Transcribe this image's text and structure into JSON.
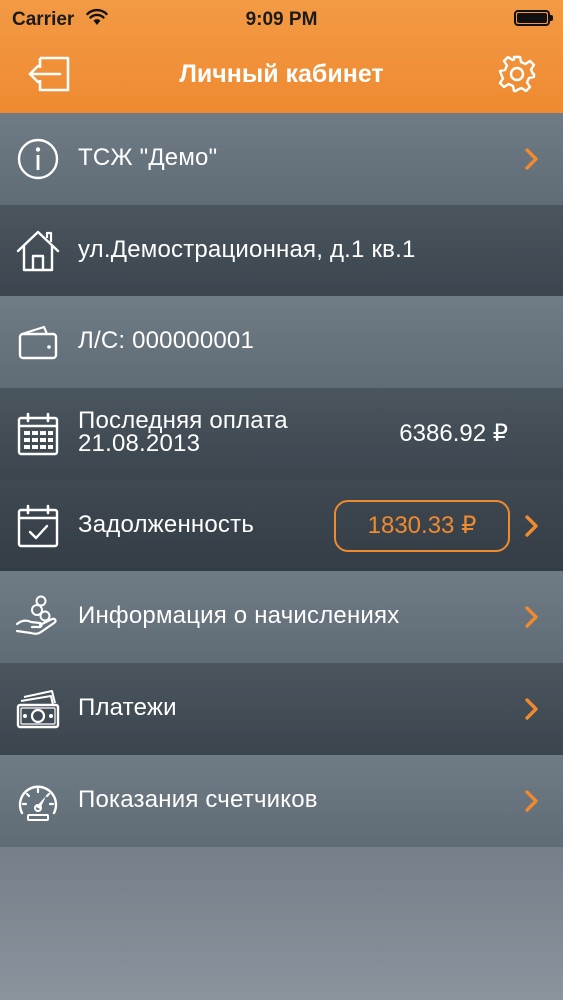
{
  "status_bar": {
    "carrier": "Carrier",
    "time": "9:09 PM"
  },
  "header": {
    "title": "Личный кабинет",
    "left_icon": "logout-icon",
    "right_icon": "gear-icon"
  },
  "colors": {
    "accent": "#f08a2e",
    "header_bg": "#ef8c33",
    "row_light": "#66727c",
    "row_dark": "#434d56",
    "text": "#ffffff"
  },
  "menu": {
    "items": [
      {
        "icon": "info-icon",
        "label": "ТСЖ \"Демо\"",
        "chevron": true
      },
      {
        "icon": "house-icon",
        "label": "ул.Демострационная, д.1 кв.1",
        "chevron": false
      },
      {
        "icon": "wallet-icon",
        "label": "Л/С: 000000001",
        "chevron": false
      },
      {
        "icon": "calendar-icon",
        "label_line1": "Последняя оплата",
        "label_line2": "21.08.2013",
        "value": "6386.92 ₽",
        "chevron": false
      },
      {
        "icon": "calendar-check-icon",
        "label": "Задолженность",
        "value": "1830.33 ₽",
        "chevron": true
      },
      {
        "icon": "coins-hand-icon",
        "label": "Информация о начислениях",
        "chevron": true
      },
      {
        "icon": "money-icon",
        "label": "Платежи",
        "chevron": true
      },
      {
        "icon": "gauge-icon",
        "label": "Показания счетчиков",
        "chevron": true
      }
    ]
  }
}
